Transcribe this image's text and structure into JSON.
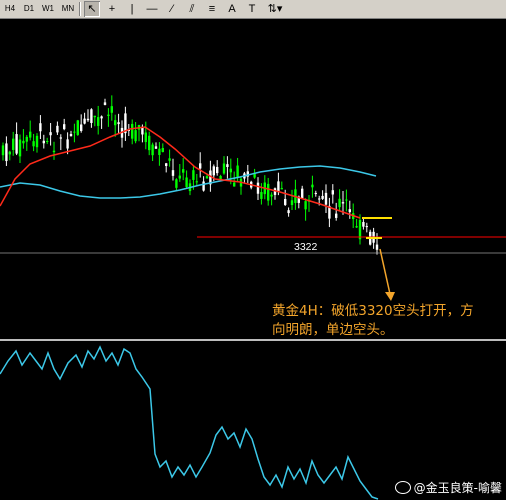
{
  "toolbar": {
    "timeframes": [
      "H4",
      "D1",
      "W1",
      "MN"
    ],
    "tools": [
      {
        "name": "cursor-icon",
        "glyph": "↖",
        "active": true
      },
      {
        "name": "crosshair-icon",
        "glyph": "+",
        "active": false
      },
      {
        "name": "vertical-line-icon",
        "glyph": "|",
        "active": false
      },
      {
        "name": "horizontal-line-icon",
        "glyph": "—",
        "active": false
      },
      {
        "name": "trendline-icon",
        "glyph": "⁄",
        "active": false
      },
      {
        "name": "channel-icon",
        "glyph": "⫽",
        "active": false
      },
      {
        "name": "fibonacci-icon",
        "glyph": "≡",
        "active": false
      },
      {
        "name": "text-icon",
        "glyph": "A",
        "active": false
      },
      {
        "name": "label-icon",
        "glyph": "T",
        "active": false
      },
      {
        "name": "arrows-dropdown-icon",
        "glyph": "⇅▾",
        "active": false
      }
    ]
  },
  "chart": {
    "level_label": "3322",
    "annotation_line1": "黄金4H：破低3320空头打开，方",
    "annotation_line2": "向明朗，单边空头。",
    "colors": {
      "bull": "#00ff00",
      "bear": "#ffffff",
      "ma_fast": "#ff2a1a",
      "ma_slow": "#3cc8e8",
      "level_line": "#ff0000",
      "indicator": "#3cc8e8",
      "annotation": "#f3a52b",
      "arrow": "#f3a52b"
    }
  },
  "watermark": {
    "text": "@金玉良策-喻馨"
  }
}
